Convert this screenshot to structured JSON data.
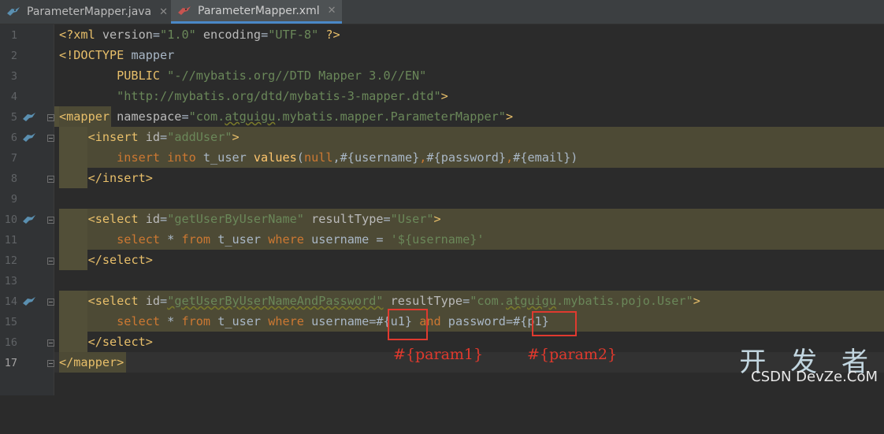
{
  "tabs": [
    {
      "label": "ParameterMapper.java",
      "active": false,
      "icon": "mybatis-bird-icon"
    },
    {
      "label": "ParameterMapper.xml",
      "active": true,
      "icon": "mybatis-bird-icon"
    }
  ],
  "close_glyph": "✕",
  "line_numbers": [
    "1",
    "2",
    "3",
    "4",
    "5",
    "6",
    "7",
    "8",
    "9",
    "10",
    "11",
    "12",
    "13",
    "14",
    "15",
    "16",
    "17"
  ],
  "code": {
    "l1": {
      "a": "<?xml ",
      "b": "version",
      "c": "=",
      "d": "\"1.0\"",
      "e": " encoding",
      "f": "=",
      "g": "\"UTF-8\"",
      "h": " ?>"
    },
    "l2": {
      "a": "<!DOCTYPE ",
      "b": "mapper"
    },
    "l3": {
      "a": "        PUBLIC ",
      "b": "\"-//mybatis.org//DTD Mapper 3.0//EN\""
    },
    "l4": {
      "a": "        \"http://mybatis.org/dtd/mybatis-3-mapper.dtd\"",
      "b": ">"
    },
    "l5": {
      "a": "<mapper",
      "b": " namespace",
      "c": "=",
      "d": "\"com.",
      "e": "atguigu",
      "f": ".mybatis.mapper.ParameterMapper\"",
      "g": ">"
    },
    "l6": {
      "a": "    ",
      "b": "<insert",
      "c": " id",
      "d": "=",
      "e": "\"addUser\"",
      "f": ">"
    },
    "l7": {
      "a": "        ",
      "b": "insert into",
      "c": " t_user ",
      "d": "values",
      "e": "(",
      "f": "null",
      "g": ",#{username}",
      "h": ",",
      "i": "#{password}",
      "j": ",",
      "k": "#{email})"
    },
    "l8": {
      "a": "    ",
      "b": "</insert>"
    },
    "l10": {
      "a": "    ",
      "b": "<select",
      "c": " id",
      "d": "=",
      "e": "\"getUserByUserName\"",
      "f": " resultType",
      "g": "=",
      "h": "\"User\"",
      "i": ">"
    },
    "l11": {
      "a": "        ",
      "b": "select",
      "c": " * ",
      "d": "from",
      "e": " t_user ",
      "f": "where",
      "g": " username = ",
      "h": "'${username}'"
    },
    "l12": {
      "a": "    ",
      "b": "</select>"
    },
    "l14": {
      "a": "    ",
      "b": "<select",
      "c": " id",
      "d": "=",
      "e": "\"getUserByUserNameAndPassword\"",
      "f": " resultType",
      "g": "=",
      "h": "\"com.",
      "i": "atguigu",
      ".j": "",
      "j": ".mybatis.pojo.User\"",
      "k": ">"
    },
    "l15": {
      "a": "        ",
      "b": "select",
      "c": " * ",
      "d": "from",
      "e": " t_user ",
      "f": "where",
      "g": " username=",
      "h": "#{u1}",
      "i": " and",
      "j": " password=",
      "k": "#{p1}"
    },
    "l16": {
      "a": "    ",
      "b": "</select>"
    },
    "l17": {
      "a": "</mapper>"
    }
  },
  "annotations": {
    "param1": "#{param1}",
    "param2": "#{param2}"
  },
  "watermark": {
    "cn": "开 发 者",
    "en": "CSDN DevZe.CoM"
  }
}
